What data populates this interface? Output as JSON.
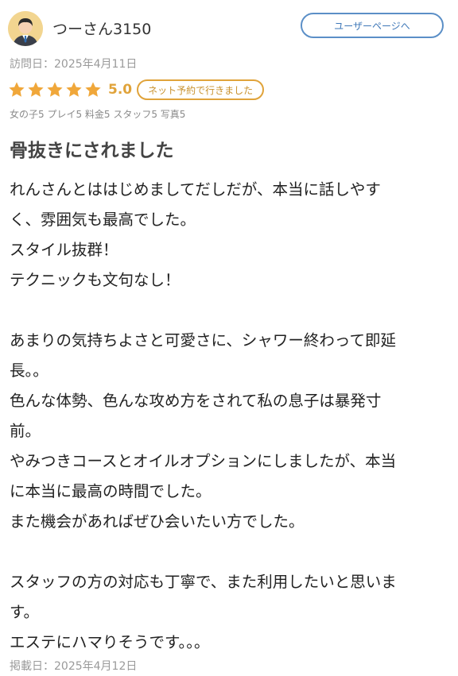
{
  "user": {
    "name": "つーさん3150",
    "page_button": "ユーザーページへ",
    "avatar_icon": "user-avatar-icon"
  },
  "visit": {
    "label": "訪問日：2025年4月11日"
  },
  "rating": {
    "stars": 5,
    "score": "5.0",
    "net_badge": "ネット予約で行きました",
    "star_color": "#f0a73a"
  },
  "sub_ratings": "女の子5 プレイ5 料金5 スタッフ5 写真5",
  "review": {
    "title": "骨抜きにされました",
    "body_lines": [
      "れんさんとははじめましてだしだが、本当に話しやす",
      "く、雰囲気も最高でした。",
      "スタイル抜群！",
      "テクニックも文句なし！",
      "",
      "あまりの気持ちよさと可愛さに、シャワー終わって即延",
      "長。。",
      "色んな体勢、色んな攻め方をされて私の息子は暴発寸",
      "前。",
      "やみつきコースとオイルオプションにしましたが、本当",
      "に本当に最高の時間でした。",
      "また機会があればぜひ会いたい方でした。",
      "",
      "スタッフの方の対応も丁寧で、また利用したいと思いま",
      "す。",
      "エステにハマりそうです。。。"
    ]
  },
  "posted": {
    "label": "掲載日：2025年4月12日"
  },
  "colors": {
    "accent_blue": "#5b8fc7",
    "accent_orange": "#e0a33a"
  }
}
